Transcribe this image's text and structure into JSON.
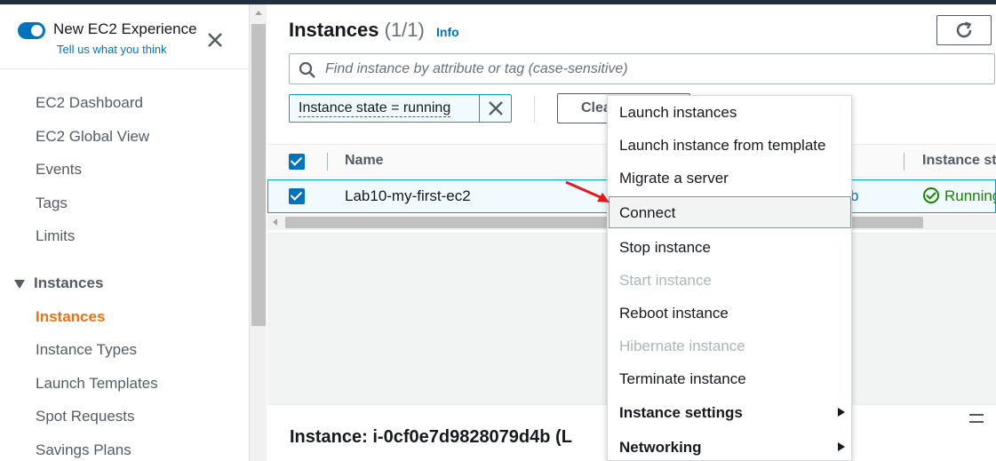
{
  "sidebar": {
    "toggle_title": "New EC2 Experience",
    "toggle_sub": "Tell us what you think",
    "items": [
      "EC2 Dashboard",
      "EC2 Global View",
      "Events",
      "Tags",
      "Limits"
    ],
    "section": "Instances",
    "section_items": [
      "Instances",
      "Instance Types",
      "Launch Templates",
      "Spot Requests",
      "Savings Plans"
    ]
  },
  "header": {
    "title": "Instances",
    "count": "(1/1)",
    "info": "Info"
  },
  "search": {
    "placeholder": "Find instance by attribute or tag (case-sensitive)"
  },
  "filter": {
    "label": "Instance state = running"
  },
  "clear_button": "Clea",
  "table": {
    "columns": [
      "Name",
      "Instance st"
    ],
    "row": {
      "name": "Lab10-my-first-ec2",
      "partial": "b",
      "state": "Running"
    }
  },
  "detail": {
    "title": "Instance: i-0cf0e7d9828079d4b (L"
  },
  "menu": {
    "items": [
      {
        "label": "Launch instances",
        "state": "enabled"
      },
      {
        "label": "Launch instance from template",
        "state": "enabled"
      },
      {
        "label": "Migrate a server",
        "state": "enabled"
      },
      {
        "label": "Connect",
        "state": "highlighted"
      },
      {
        "label": "Stop instance",
        "state": "enabled"
      },
      {
        "label": "Start instance",
        "state": "disabled"
      },
      {
        "label": "Reboot instance",
        "state": "enabled"
      },
      {
        "label": "Hibernate instance",
        "state": "disabled"
      },
      {
        "label": "Terminate instance",
        "state": "enabled"
      },
      {
        "label": "Instance settings",
        "state": "submenu"
      },
      {
        "label": "Networking",
        "state": "submenu"
      }
    ]
  },
  "colors": {
    "accent": "#0073bb",
    "active_nav": "#ec7211",
    "running": "#1d8102",
    "arrow": "#e3191c"
  }
}
